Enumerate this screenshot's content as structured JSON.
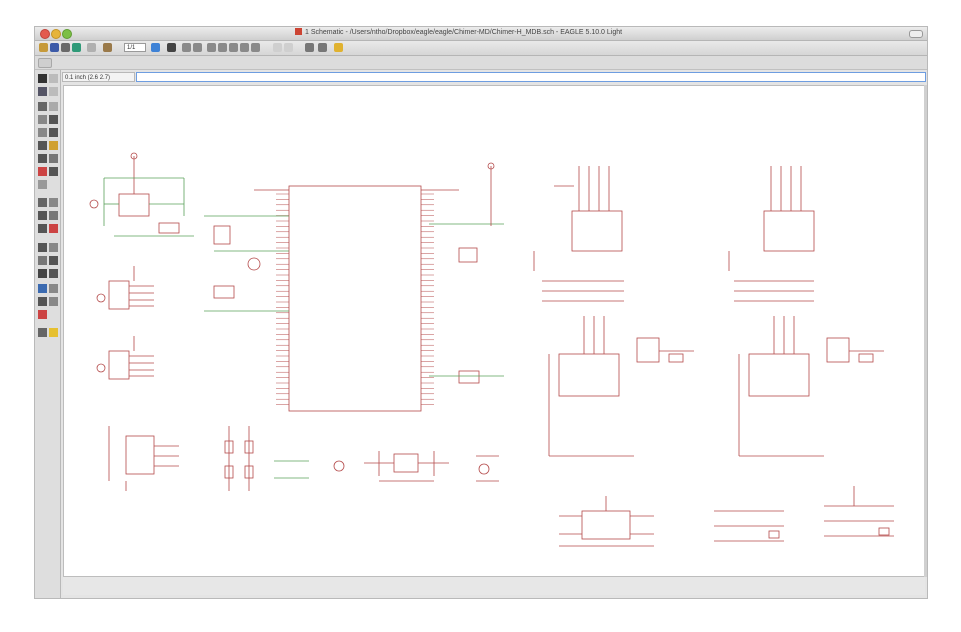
{
  "window": {
    "title": "1 Schematic - /Users/ntho/Dropbox/eagle/eagle/Chimer-MD/Chimer-H_MDB.sch - EAGLE 5.10.0 Light"
  },
  "toolbar": {
    "zoom_value": "1/1"
  },
  "command": {
    "coordinate": "0.1 inch (2.6 2.7)",
    "command_line_value": ""
  },
  "status": {
    "message": ""
  },
  "colors": {
    "schematic_lines": "#b44a4a",
    "net_lines": "#5aa05a",
    "background": "#ffffff",
    "accent": "#3e82d6"
  },
  "icons": [
    "open-icon",
    "save-icon",
    "print-icon",
    "cam-icon",
    "layer-icon",
    "zoom-field",
    "window-icon",
    "zoom-fit-icon",
    "zoom-in-icon",
    "zoom-out-icon",
    "redraw-icon",
    "zoom-select-icon",
    "undo-icon",
    "redo-icon",
    "stop-icon",
    "go-icon",
    "help-icon"
  ]
}
